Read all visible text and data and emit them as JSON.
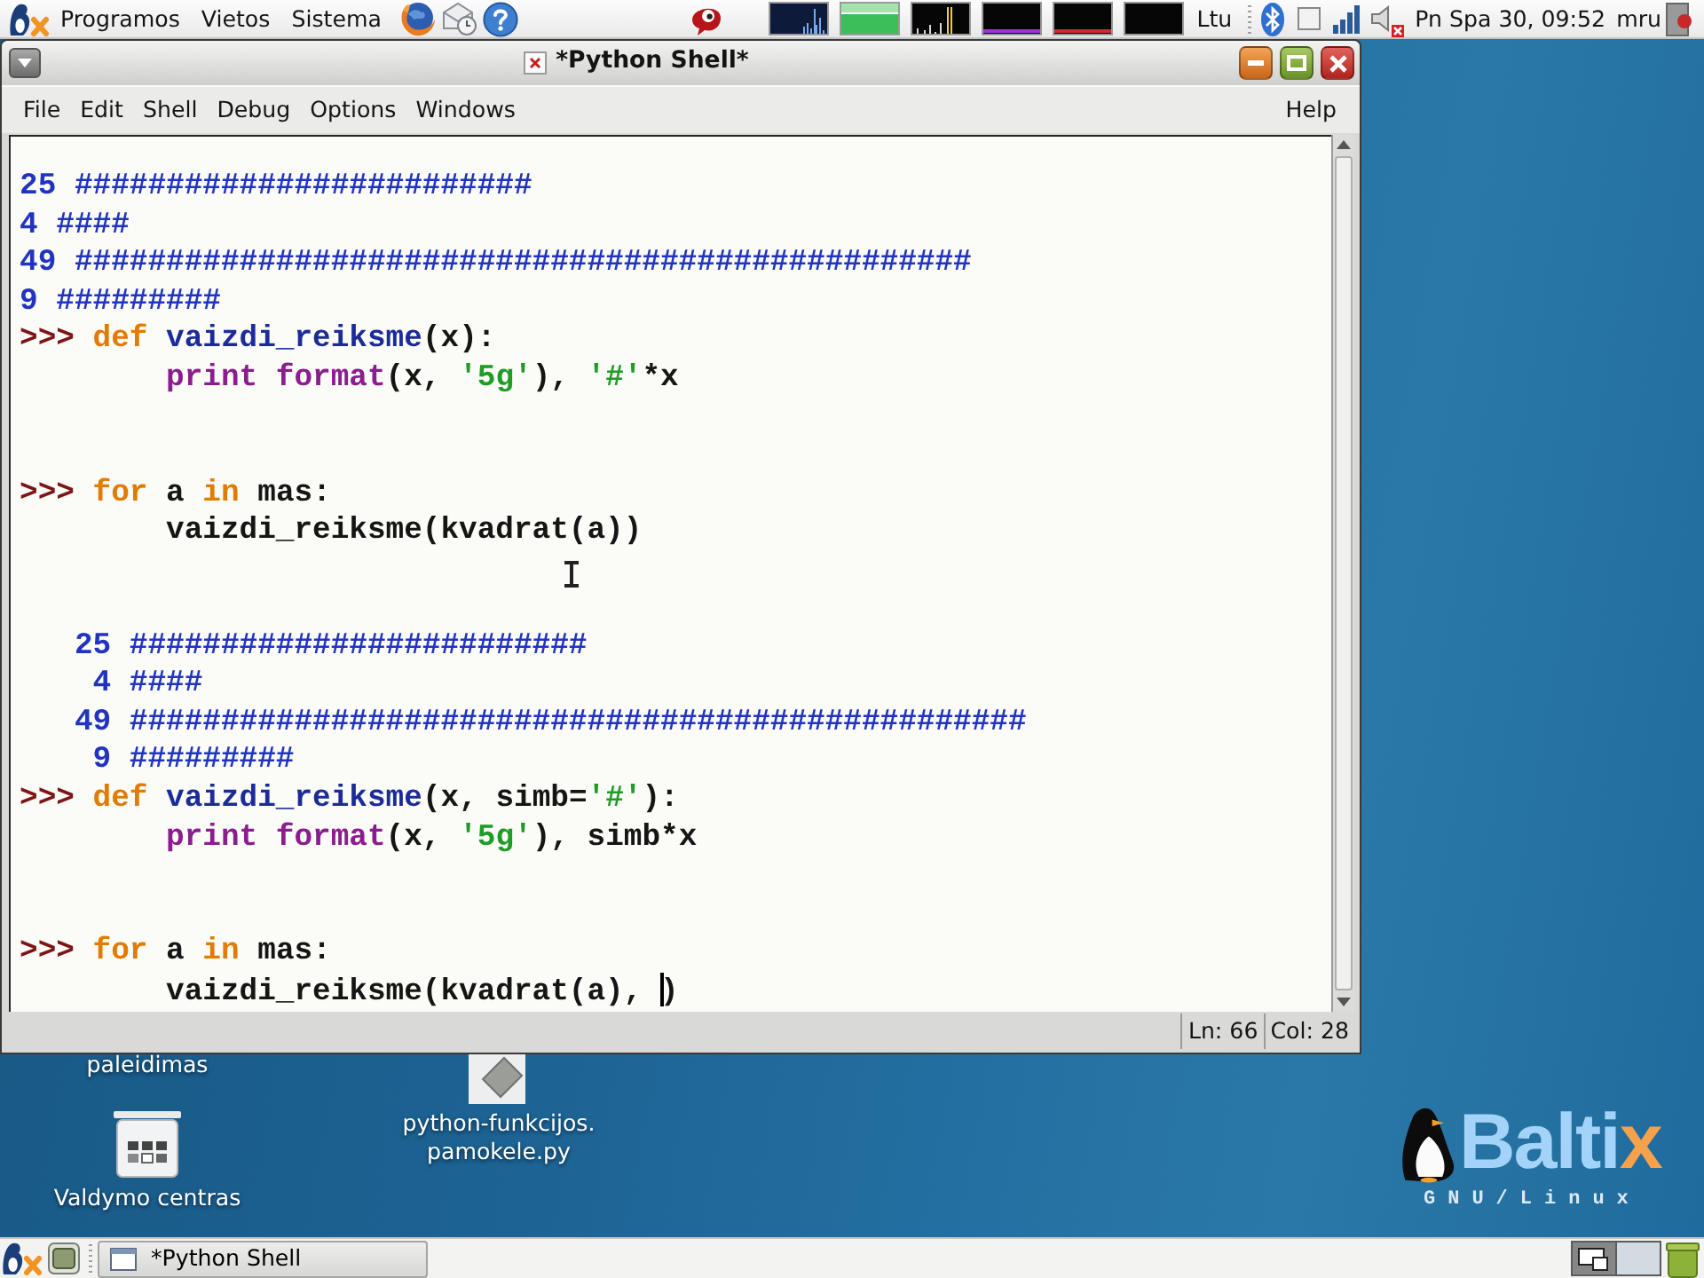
{
  "top_panel": {
    "menus": [
      {
        "label": "Programos"
      },
      {
        "label": "Vietos"
      },
      {
        "label": "Sistema"
      }
    ],
    "keyboard_layout": "Ltu",
    "clock": "Pn Spa 30, 09:52",
    "user": "mru"
  },
  "window": {
    "title": "*Python Shell*",
    "menus": [
      {
        "label": "File"
      },
      {
        "label": "Edit"
      },
      {
        "label": "Shell"
      },
      {
        "label": "Debug"
      },
      {
        "label": "Options"
      },
      {
        "label": "Windows"
      }
    ],
    "help_menu": {
      "label": "Help"
    },
    "shell_lines": [
      {
        "kind": "output",
        "text": "25 #########################"
      },
      {
        "kind": "output",
        "text": "4 ####"
      },
      {
        "kind": "output",
        "text": "49 #################################################"
      },
      {
        "kind": "output",
        "text": "9 #########"
      },
      {
        "kind": "input",
        "tokens": [
          {
            "kind": "prompt",
            "text": ">>> "
          },
          {
            "kind": "keyword",
            "text": "def "
          },
          {
            "kind": "definition",
            "text": "vaizdi_reiksme"
          },
          {
            "kind": "plain",
            "text": "(x):"
          }
        ]
      },
      {
        "kind": "input",
        "tokens": [
          {
            "kind": "builtin",
            "text": "        print format"
          },
          {
            "kind": "plain",
            "text": "(x, "
          },
          {
            "kind": "string",
            "text": "'5g'"
          },
          {
            "kind": "plain",
            "text": "), "
          },
          {
            "kind": "string",
            "text": "'#'"
          },
          {
            "kind": "plain",
            "text": "*x"
          }
        ]
      },
      {
        "kind": "blank"
      },
      {
        "kind": "blank"
      },
      {
        "kind": "input",
        "tokens": [
          {
            "kind": "prompt",
            "text": ">>> "
          },
          {
            "kind": "keyword",
            "text": "for "
          },
          {
            "kind": "plain",
            "text": "a "
          },
          {
            "kind": "keyword",
            "text": "in "
          },
          {
            "kind": "plain",
            "text": "mas:"
          }
        ]
      },
      {
        "kind": "input",
        "tokens": [
          {
            "kind": "plain",
            "text": "        vaizdi_reiksme(kvadrat(a))"
          }
        ]
      },
      {
        "kind": "blank"
      },
      {
        "kind": "blank"
      },
      {
        "kind": "output",
        "text": "   25 #########################"
      },
      {
        "kind": "output",
        "text": "    4 ####"
      },
      {
        "kind": "output",
        "text": "   49 #################################################"
      },
      {
        "kind": "output",
        "text": "    9 #########"
      },
      {
        "kind": "input",
        "tokens": [
          {
            "kind": "prompt",
            "text": ">>> "
          },
          {
            "kind": "keyword",
            "text": "def "
          },
          {
            "kind": "definition",
            "text": "vaizdi_reiksme"
          },
          {
            "kind": "plain",
            "text": "(x, simb="
          },
          {
            "kind": "string",
            "text": "'#'"
          },
          {
            "kind": "plain",
            "text": "):"
          }
        ]
      },
      {
        "kind": "input",
        "tokens": [
          {
            "kind": "builtin",
            "text": "        print format"
          },
          {
            "kind": "plain",
            "text": "(x, "
          },
          {
            "kind": "string",
            "text": "'5g'"
          },
          {
            "kind": "plain",
            "text": "), simb*x"
          }
        ]
      },
      {
        "kind": "blank"
      },
      {
        "kind": "blank"
      },
      {
        "kind": "input",
        "tokens": [
          {
            "kind": "prompt",
            "text": ">>> "
          },
          {
            "kind": "keyword",
            "text": "for "
          },
          {
            "kind": "plain",
            "text": "a "
          },
          {
            "kind": "keyword",
            "text": "in "
          },
          {
            "kind": "plain",
            "text": "mas:"
          }
        ]
      },
      {
        "kind": "input",
        "tokens": [
          {
            "kind": "plain",
            "text": "        vaizdi_reiksme(kvadrat(a), "
          },
          {
            "kind": "caret"
          },
          {
            "kind": "plain",
            "text": ")"
          }
        ]
      }
    ],
    "status_bar": {
      "line": "Ln: 66",
      "column": "Col: 28"
    }
  },
  "desktop_icons": [
    {
      "kind": "covered",
      "label_lines": [
        "paleidimas"
      ]
    },
    {
      "kind": "control_panel",
      "label_lines": [
        "Valdymo centras"
      ]
    },
    {
      "kind": "script_file",
      "label_lines": [
        "python-funkcijos.",
        "pamokele.py"
      ]
    }
  ],
  "logo": {
    "wordmark": "Baltix",
    "tagline": "GNU/Linux"
  },
  "taskbar": {
    "tasks": [
      {
        "label": "*Python Shell"
      }
    ],
    "workspaces": [
      {
        "selected": true
      },
      {
        "selected": false
      }
    ]
  }
}
